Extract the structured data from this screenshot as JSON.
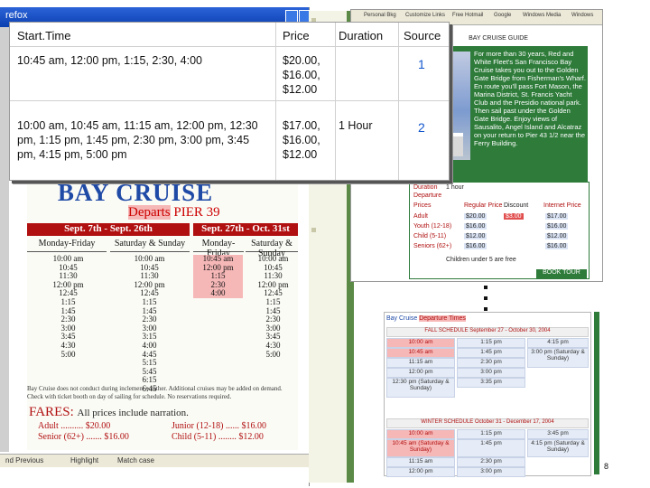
{
  "left_window": {
    "title": "refox",
    "statusbar": {
      "find_previous": "nd Previous",
      "highlight": "Highlight",
      "match_case": "Match case"
    }
  },
  "schedule": {
    "title": "BAY CRUISE",
    "departs_prefix": "Departs",
    "departs_pier": "PIER 39",
    "range1": "Sept. 7th - Sept. 26th",
    "range2": "Sept. 27th - Oct. 31st",
    "sub1": "Monday-Friday",
    "sub2": "Saturday & Sunday",
    "sub3": "Monday-Friday",
    "sub4": "Saturday & Sunday",
    "col1": [
      "10:00 am",
      "10:45",
      "11:30",
      "12:00 pm",
      "12:45",
      "1:15",
      "1:45",
      "2:30",
      "3:00",
      "3:45",
      "4:30",
      "5:00"
    ],
    "col2": [
      "10:00 am",
      "10:45",
      "11:30",
      "12:00 pm",
      "12:45",
      "1:15",
      "1:45",
      "2:30",
      "3:00",
      "3:15",
      "4:00",
      "4:45",
      "5:15",
      "5:45",
      "6:15",
      "6:45"
    ],
    "col3": [
      "10:45 am",
      "12:00 pm",
      "1:15",
      "2:30",
      "4:00"
    ],
    "col4": [
      "10:00 am",
      "10:45",
      "11:30",
      "12:00 pm",
      "12:45",
      "1:15",
      "1:45",
      "2:30",
      "3:00",
      "3:45",
      "4:30",
      "5:00"
    ],
    "note": "Bay Cruise does not conduct during inclement weather. Additional cruises may be added on demand. Check with ticket booth on day of sailing for schedule. No reservations required.",
    "fares_label": "FARES:",
    "fares_sub": "All prices include narration.",
    "adult": "Adult .......... $20.00",
    "senior": "Senior (62+) ....... $16.00",
    "junior": "Junior (12-18) ...... $16.00",
    "child": "Child (5-11) ........ $12.00"
  },
  "right_window": {
    "toolbar": [
      "Personal Bkg",
      "Customize Links",
      "Free Hotmail",
      "Google",
      "Windows Media",
      "Windows"
    ],
    "site_header": "BAY CRUISE GUIDE",
    "site_text": "For more than 30 years, Red and White Fleet's San Francisco Bay Cruise takes you out to the Golden Gate Bridge from Fisherman's Wharf. En route you'll pass Fort Mason, the Marina District, St. Francis Yacht Club and the Presidio national park. Then sail past under the Golden Gate Bridge. Enjoy views of Sausalito, Angel Island and Alcatraz on your return to Pier 43 1/2 near the Ferry Building.",
    "duration_label": "Duration",
    "duration_val": "1 hour",
    "departure_label": "Departure",
    "prices_header": "Prices",
    "regular_price": "Regular Price",
    "discount": "Discount",
    "internet_price": "Internet Price",
    "rows": [
      {
        "label": "Adult",
        "regular": "$20.00",
        "discount": "$3.00",
        "internet": "$17.00"
      },
      {
        "label": "Youth (12-18)",
        "regular": "$16.00",
        "discount": "",
        "internet": "$16.00"
      },
      {
        "label": "Child (5-11)",
        "regular": "$12.00",
        "discount": "",
        "internet": "$12.00"
      },
      {
        "label": "Seniors (62+)",
        "regular": "$16.00",
        "discount": "",
        "internet": "$16.00"
      }
    ],
    "footnote": "Children under 5 are free",
    "book_tour": "BOOK TOUR"
  },
  "departures": {
    "title_prefix": "Bay Cruise",
    "title_hl": "Departure Times",
    "fall_schedule": "FALL SCHEDULE September 27 - October 30, 2004",
    "winter_schedule": "WINTER SCHEDULE October 31 - December 17, 2004",
    "fall_c1": [
      "10:00 am",
      "10:45 am",
      "11:15 am",
      "12:00 pm",
      "12:30 pm (Saturday & Sunday)"
    ],
    "fall_c2": [
      "1:15 pm",
      "1:45 pm",
      "2:30 pm",
      "3:00 pm",
      "3:35 pm"
    ],
    "fall_c3": [
      "4:15 pm",
      "3:00 pm (Saturday & Sunday)"
    ],
    "winter_c1": [
      "10:00 am",
      "10:45 am (Saturday & Sunday)",
      "11:15 am",
      "12:00 pm"
    ],
    "winter_c2": [
      "1:15 pm",
      "1:45 pm",
      "2:30 pm",
      "3:00 pm"
    ],
    "winter_c3": [
      "3:45 pm",
      "4:15 pm (Saturday & Sunday)"
    ]
  },
  "page_number": "8",
  "table": {
    "headers": [
      "Start.Time",
      "Price",
      "Duration",
      "Source"
    ],
    "rows": [
      {
        "start_time": "10:45 am, 12:00 pm, 1:15, 2:30, 4:00",
        "price": "$20.00, $16.00, $12.00",
        "duration": "",
        "source": "1"
      },
      {
        "start_time": "10:00 am, 10:45 am, 11:15 am, 12:00 pm, 12:30 pm, 1:15 pm, 1:45 pm, 2:30 pm, 3:00 pm, 3:45 pm, 4:15 pm, 5:00 pm",
        "price": "$17.00, $16.00, $12.00",
        "duration": "1 Hour",
        "source": "2"
      }
    ]
  }
}
